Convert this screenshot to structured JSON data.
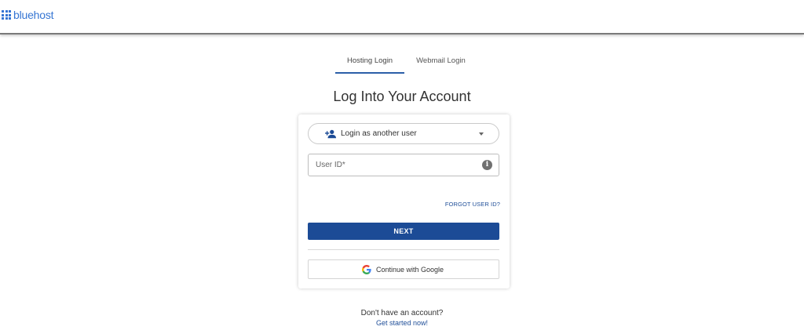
{
  "brand": {
    "name": "bluehost",
    "color": "#3575d3"
  },
  "tabs": [
    {
      "label": "Hosting Login",
      "active": true
    },
    {
      "label": "Webmail Login",
      "active": false
    }
  ],
  "page": {
    "title": "Log Into Your Account"
  },
  "login": {
    "account_selector_label": "Login as another user",
    "account_selector_icon": "person-add-icon",
    "user_id_placeholder": "User ID*",
    "user_id_value": "",
    "info_icon": "info-icon",
    "forgot_label": "FORGOT USER ID?",
    "next_label": "NEXT",
    "google_label": "Continue with Google",
    "google_icon": "google-g-icon"
  },
  "signup": {
    "question": "Don't have an account?",
    "link_label": "Get started now!"
  },
  "colors": {
    "primary_button": "#1c4b96",
    "link": "#1f4e98",
    "tab_underline": "#2b5fa8"
  }
}
